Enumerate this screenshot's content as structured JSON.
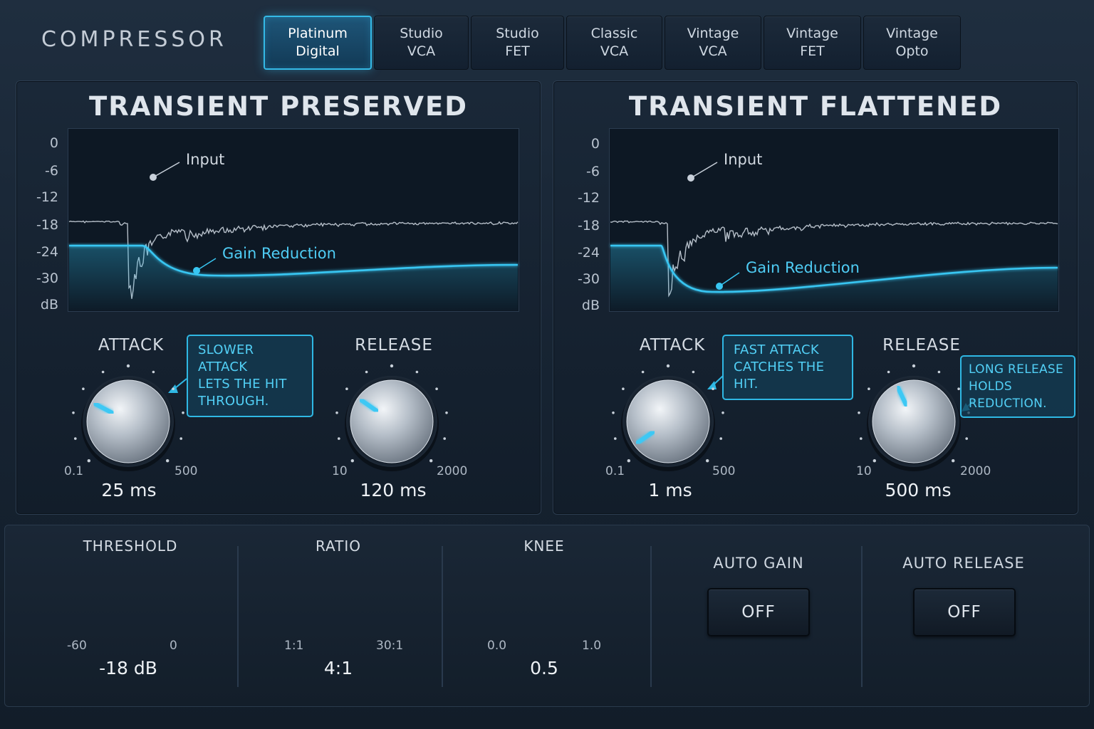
{
  "app_title": "COMPRESSOR",
  "accent_color": "#34b9e6",
  "tabs": [
    {
      "line1": "Platinum",
      "line2": "Digital",
      "active": true
    },
    {
      "line1": "Studio",
      "line2": "VCA",
      "active": false
    },
    {
      "line1": "Studio",
      "line2": "FET",
      "active": false
    },
    {
      "line1": "Classic",
      "line2": "VCA",
      "active": false
    },
    {
      "line1": "Vintage",
      "line2": "VCA",
      "active": false
    },
    {
      "line1": "Vintage",
      "line2": "FET",
      "active": false
    },
    {
      "line1": "Vintage",
      "line2": "Opto",
      "active": false
    }
  ],
  "db_scale": [
    "0",
    "-6",
    "-12",
    "-18",
    "-24",
    "-30",
    "dB"
  ],
  "panels": [
    {
      "title": "TRANSIENT PRESERVED",
      "input_label": "Input",
      "gain_reduction_label": "Gain Reduction",
      "attack": {
        "label": "ATTACK",
        "min": "0.1",
        "max": "500",
        "value": "25 ms",
        "callout": [
          "SLOWER ATTACK",
          "LETS THE HIT",
          "THROUGH."
        ]
      },
      "release": {
        "label": "RELEASE",
        "min": "10",
        "max": "2000",
        "value": "120 ms"
      }
    },
    {
      "title": "TRANSIENT FLATTENED",
      "input_label": "Input",
      "gain_reduction_label": "Gain Reduction",
      "attack": {
        "label": "ATTACK",
        "min": "0.1",
        "max": "500",
        "value": "1 ms",
        "callout": [
          "FAST ATTACK",
          "CATCHES THE HIT."
        ]
      },
      "release": {
        "label": "RELEASE",
        "min": "10",
        "max": "2000",
        "value": "500 ms",
        "callout": [
          "LONG RELEASE",
          "HOLDS REDUCTION."
        ]
      }
    }
  ],
  "bottom": {
    "threshold": {
      "label": "THRESHOLD",
      "min": "-60",
      "max": "0",
      "value": "-18 dB"
    },
    "ratio": {
      "label": "RATIO",
      "min": "1:1",
      "max": "30:1",
      "value": "4:1"
    },
    "knee": {
      "label": "KNEE",
      "min": "0.0",
      "max": "1.0",
      "value": "0.5"
    },
    "auto_gain": {
      "label": "AUTO GAIN",
      "state": "OFF"
    },
    "auto_release": {
      "label": "AUTO RELEASE",
      "state": "OFF"
    }
  }
}
